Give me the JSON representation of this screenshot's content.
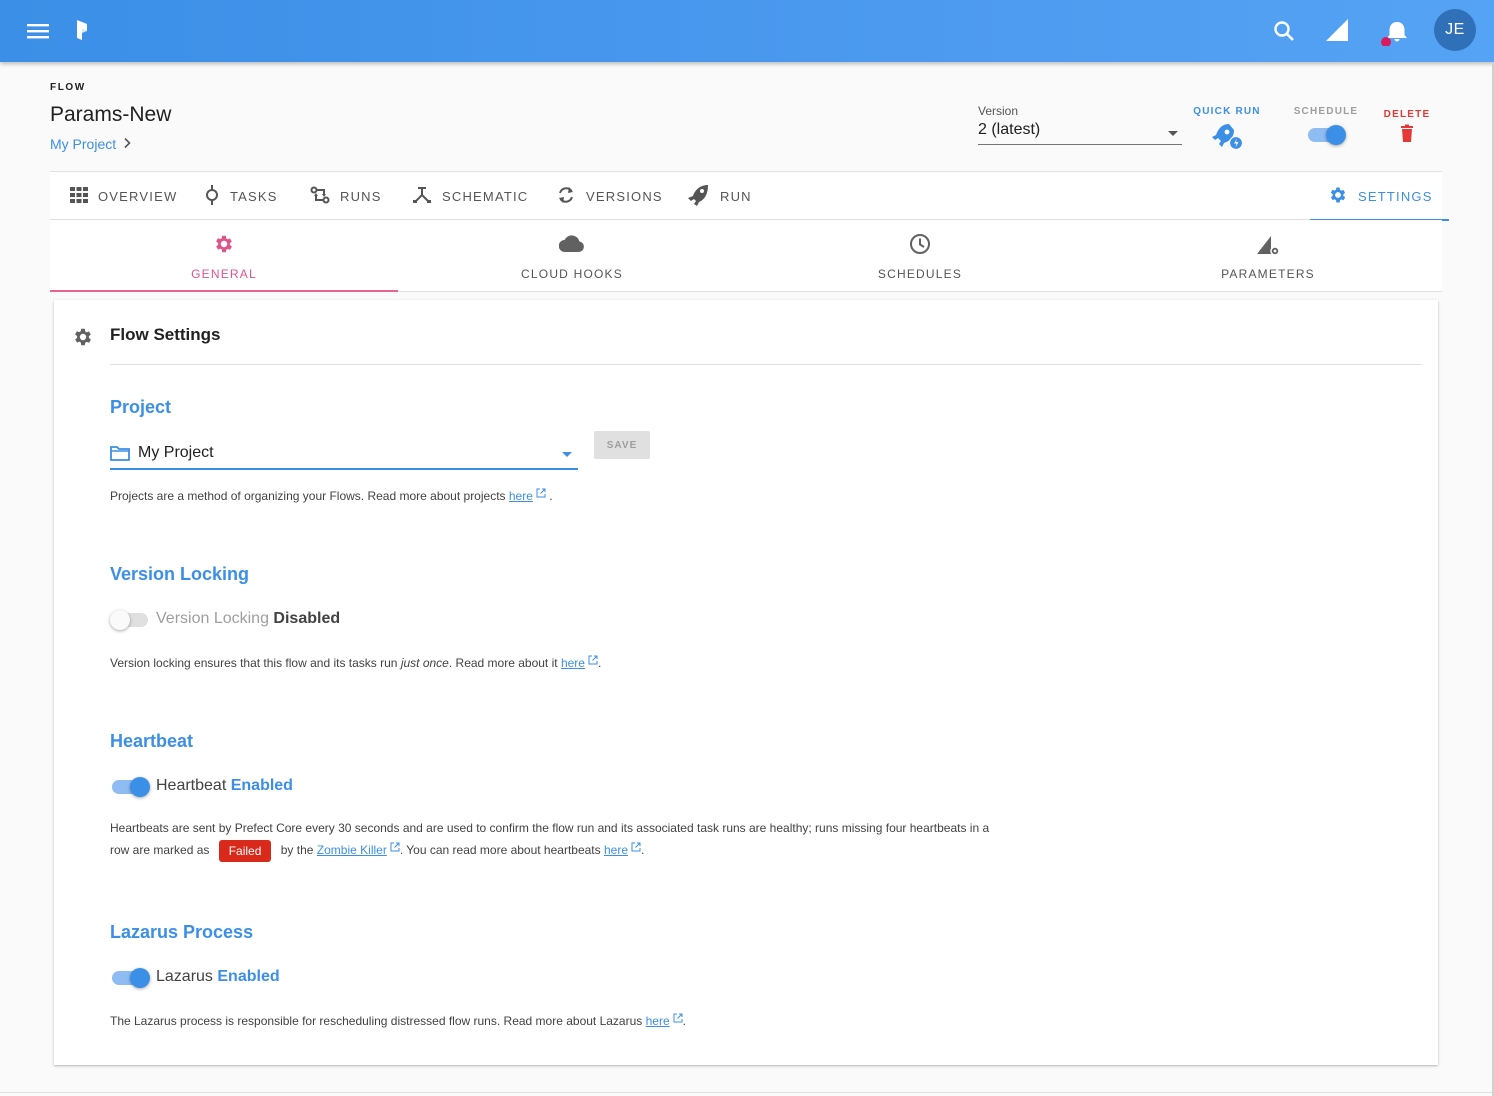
{
  "appbar": {
    "avatar_initials": "JE",
    "colors": {
      "bar": "#4b9af0",
      "avatar": "#2f70b8",
      "notification_dot": "#d81b60"
    },
    "icons": [
      "menu-icon",
      "prefect-logo",
      "search-icon",
      "signal-icon",
      "bell-icon"
    ]
  },
  "flow": {
    "label": "FLOW",
    "name": "Params-New",
    "project_link": "My Project"
  },
  "version": {
    "label": "Version",
    "selected": "2 (latest)"
  },
  "actions": {
    "quick_run": "QUICK RUN",
    "schedule": "SCHEDULE",
    "schedule_enabled": true,
    "delete": "DELETE"
  },
  "tabs": {
    "overview": "OVERVIEW",
    "tasks": "TASKS",
    "runs": "RUNS",
    "schematic": "SCHEMATIC",
    "versions": "VERSIONS",
    "run": "RUN",
    "settings": "SETTINGS",
    "active": "SETTINGS"
  },
  "subtabs": {
    "general": "GENERAL",
    "cloud_hooks": "CLOUD HOOKS",
    "schedules": "SCHEDULES",
    "parameters": "PARAMETERS",
    "active": "GENERAL"
  },
  "settings": {
    "title": "Flow Settings",
    "project": {
      "heading": "Project",
      "selected": "My Project",
      "save": "SAVE",
      "desc": "Projects are a method of organizing your Flows. Read more about projects",
      "link": "here",
      "tail": "."
    },
    "version_locking": {
      "heading": "Version Locking",
      "label": "Version Locking",
      "state": "Disabled",
      "enabled": false,
      "desc_a": "Version locking ensures that this flow and its tasks run",
      "desc_em": "just once",
      "desc_b": ". Read more about it",
      "link": "here",
      "tail": "."
    },
    "heartbeat": {
      "heading": "Heartbeat",
      "label": "Heartbeat",
      "state": "Enabled",
      "enabled": true,
      "desc_line1": "Heartbeats are sent by Prefect Core every 30 seconds and are used to confirm the flow run and its associated task runs are healthy; runs missing four heartbeats in a",
      "desc_a": "row are marked as",
      "badge": "Failed",
      "desc_b": "by the",
      "zombie_link": "Zombie Killer",
      "desc_c": ". You can read more about heartbeats",
      "link": "here",
      "tail": "."
    },
    "lazarus": {
      "heading": "Lazarus Process",
      "label": "Lazarus",
      "state": "Enabled",
      "enabled": true,
      "desc": "The Lazarus process is responsible for rescheduling distressed flow runs. Read more about Lazarus",
      "link": "here",
      "tail": "."
    }
  }
}
